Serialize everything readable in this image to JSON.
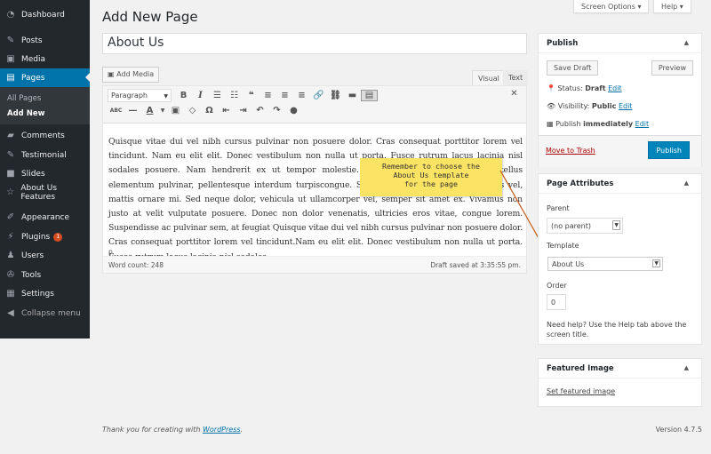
{
  "sidebar": {
    "items": [
      {
        "label": "Dashboard",
        "icon": "dashboard-icon"
      },
      {
        "label": "Posts",
        "icon": "pin-icon"
      },
      {
        "label": "Media",
        "icon": "media-icon"
      },
      {
        "label": "Pages",
        "icon": "pages-icon"
      },
      {
        "label": "Comments",
        "icon": "comment-icon"
      },
      {
        "label": "Testimonial",
        "icon": "pin-icon"
      },
      {
        "label": "Slides",
        "icon": "slides-icon"
      },
      {
        "label": "About Us Features",
        "icon": "star-icon"
      },
      {
        "label": "Appearance",
        "icon": "brush-icon"
      },
      {
        "label": "Plugins",
        "icon": "plugin-icon",
        "badge": "1"
      },
      {
        "label": "Users",
        "icon": "user-icon"
      },
      {
        "label": "Tools",
        "icon": "wrench-icon"
      },
      {
        "label": "Settings",
        "icon": "settings-icon"
      },
      {
        "label": "Collapse menu",
        "icon": "collapse-icon"
      }
    ],
    "submenu": [
      "All Pages",
      "Add New"
    ]
  },
  "top": {
    "screen_options": "Screen Options ▾",
    "help": "Help ▾"
  },
  "page_title": "Add New Page",
  "post_title": "About Us",
  "editor": {
    "add_media": "Add Media",
    "tab_visual": "Visual",
    "tab_text": "Text",
    "format": "Paragraph",
    "content": "Quisque vitae dui vel nibh cursus pulvinar non posuere dolor. Cras consequat porttitor lorem vel tincidunt. Nam eu elit elit. Donec vestibulum non nulla ut porta. Fusce rutrum lacus lacinia nisl sodales posuere. Nam hendrerit ex ut tempor molestie. Maecenas malesuada ante id tellus elementum pulvinar, pellentesque interdum turpiscongue. Sed eros diam, scelerisque at felis vel, mattis ornare mi. Sed neque dolor, vehicula ut ullamcorper vel, semper sit amet ex. Vivamus non justo at velit vulputate posuere. Donec non dolor venenatis, ultricies eros vitae, congue lorem. Suspendisse ac pulvinar sem, at feugiat Quisque vitae dui vel nibh cursus pulvinar non posuere dolor. Cras consequat porttitor lorem vel tincidunt.Nam eu elit elit. Donec vestibulum non nulla ut porta. Fusce rutrum lacus lacinia nisl sodales",
    "path": "p",
    "word_count": "Word count: 248",
    "draft_saved": "Draft saved at 3:35:55 pm."
  },
  "publish": {
    "title": "Publish",
    "save_draft": "Save Draft",
    "preview": "Preview",
    "status_label": "Status:",
    "status": "Draft",
    "visibility_label": "Visibility:",
    "visibility": "Public",
    "publish_label": "Publish",
    "publish_when": "immediately",
    "edit": "Edit",
    "trash": "Move to Trash",
    "publish_btn": "Publish"
  },
  "attributes": {
    "title": "Page Attributes",
    "parent_label": "Parent",
    "parent": "(no parent)",
    "template_label": "Template",
    "template": "About Us",
    "order_label": "Order",
    "order": "0",
    "help": "Need help? Use the Help tab above the screen title."
  },
  "featured": {
    "title": "Featured Image",
    "link": "Set featured image"
  },
  "callout": {
    "line1": "Remember to choose the",
    "line2": "About Us template",
    "line3": "for the page"
  },
  "footer": {
    "thanks": "Thank you for creating with ",
    "wp": "WordPress",
    "end": ".",
    "version": "Version 4.7.5"
  },
  "colors": {
    "accent": "#0073aa",
    "callout": "#fbe363",
    "highlight": "#e07b25"
  }
}
